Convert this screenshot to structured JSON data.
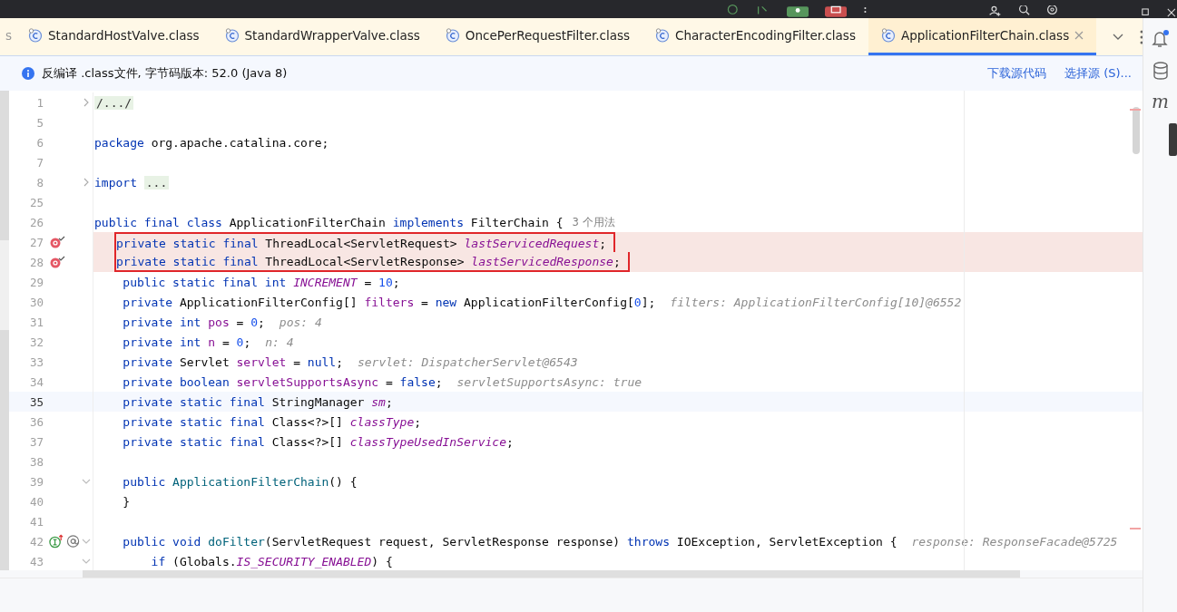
{
  "tabs": [
    {
      "label": "s",
      "icon": false,
      "selected": false,
      "closable": false
    },
    {
      "label": "StandardHostValve.class",
      "icon": true,
      "selected": false,
      "closable": false
    },
    {
      "label": "StandardWrapperValve.class",
      "icon": true,
      "selected": false,
      "closable": false
    },
    {
      "label": "OncePerRequestFilter.class",
      "icon": true,
      "selected": false,
      "closable": false
    },
    {
      "label": "CharacterEncodingFilter.class",
      "icon": true,
      "selected": false,
      "closable": false
    },
    {
      "label": "ApplicationFilterChain.class",
      "icon": true,
      "selected": true,
      "closable": true
    }
  ],
  "info_bar": {
    "message": "反编译 .class文件, 字节码版本: 52.0 (Java 8)",
    "links": [
      "下载源代码",
      "选择源 (S)..."
    ]
  },
  "side_toolbar": {
    "letter_tool": "m"
  },
  "lines": [
    {
      "num": "1",
      "expanded": false,
      "segments": [
        {
          "kind": "folded",
          "text": "/.../"
        }
      ]
    },
    {
      "num": "5"
    },
    {
      "num": "6",
      "segments": [
        {
          "kind": "kw",
          "text": "package "
        },
        {
          "kind": "plain",
          "text": "org.apache.catalina.core;"
        }
      ]
    },
    {
      "num": "7"
    },
    {
      "num": "8",
      "expanded": false,
      "segments": [
        {
          "kind": "kw",
          "text": "import "
        },
        {
          "kind": "folded",
          "text": "..."
        }
      ]
    },
    {
      "num": "25"
    },
    {
      "num": "26",
      "segments": [
        {
          "kind": "kw",
          "text": "public final class"
        },
        {
          "kind": "plain",
          "text": " ApplicationFilterChain "
        },
        {
          "kind": "kw",
          "text": "implements"
        },
        {
          "kind": "plain",
          "text": " FilterChain {"
        },
        {
          "kind": "usages",
          "text": "3 个用法"
        }
      ]
    },
    {
      "num": "27",
      "breakpoint": true,
      "highlighted": true,
      "boxed": true,
      "segments": [
        {
          "kind": "kw",
          "text": "    private static final"
        },
        {
          "kind": "plain",
          "text": " ThreadLocal<ServletRequest> "
        },
        {
          "kind": "static",
          "text": "lastServicedRequest"
        },
        {
          "kind": "plain",
          "text": ";"
        }
      ]
    },
    {
      "num": "28",
      "breakpoint": true,
      "highlighted": true,
      "boxed": true,
      "segments": [
        {
          "kind": "kw",
          "text": "    private static final"
        },
        {
          "kind": "plain",
          "text": " ThreadLocal<ServletResponse> "
        },
        {
          "kind": "static",
          "text": "lastServicedResponse"
        },
        {
          "kind": "plain",
          "text": ";"
        }
      ]
    },
    {
      "num": "29",
      "segments": [
        {
          "kind": "kw",
          "text": "    public static final int "
        },
        {
          "kind": "static",
          "text": "INCREMENT"
        },
        {
          "kind": "plain",
          "text": " = "
        },
        {
          "kind": "num",
          "text": "10"
        },
        {
          "kind": "plain",
          "text": ";"
        }
      ]
    },
    {
      "num": "30",
      "segments": [
        {
          "kind": "kw",
          "text": "    private"
        },
        {
          "kind": "plain",
          "text": " ApplicationFilterConfig[] "
        },
        {
          "kind": "field",
          "text": "filters"
        },
        {
          "kind": "plain",
          "text": " = "
        },
        {
          "kind": "kw",
          "text": "new"
        },
        {
          "kind": "plain",
          "text": " ApplicationFilterConfig["
        },
        {
          "kind": "num",
          "text": "0"
        },
        {
          "kind": "plain",
          "text": "];"
        },
        {
          "kind": "hint",
          "text": "filters: ApplicationFilterConfig[10]@6552"
        }
      ]
    },
    {
      "num": "31",
      "segments": [
        {
          "kind": "kw",
          "text": "    private int "
        },
        {
          "kind": "field",
          "text": "pos"
        },
        {
          "kind": "plain",
          "text": " = "
        },
        {
          "kind": "num",
          "text": "0"
        },
        {
          "kind": "plain",
          "text": ";"
        },
        {
          "kind": "hint",
          "text": "pos: 4"
        }
      ]
    },
    {
      "num": "32",
      "segments": [
        {
          "kind": "kw",
          "text": "    private int "
        },
        {
          "kind": "field",
          "text": "n"
        },
        {
          "kind": "plain",
          "text": " = "
        },
        {
          "kind": "num",
          "text": "0"
        },
        {
          "kind": "plain",
          "text": ";"
        },
        {
          "kind": "hint",
          "text": "n: 4"
        }
      ]
    },
    {
      "num": "33",
      "segments": [
        {
          "kind": "kw",
          "text": "    private"
        },
        {
          "kind": "plain",
          "text": " Servlet "
        },
        {
          "kind": "field",
          "text": "servlet"
        },
        {
          "kind": "plain",
          "text": " = "
        },
        {
          "kind": "kw",
          "text": "null"
        },
        {
          "kind": "plain",
          "text": ";"
        },
        {
          "kind": "hint",
          "text": "servlet: DispatcherServlet@6543"
        }
      ]
    },
    {
      "num": "34",
      "segments": [
        {
          "kind": "kw",
          "text": "    private boolean "
        },
        {
          "kind": "field",
          "text": "servletSupportsAsync"
        },
        {
          "kind": "plain",
          "text": " = "
        },
        {
          "kind": "kw",
          "text": "false"
        },
        {
          "kind": "plain",
          "text": ";"
        },
        {
          "kind": "hint",
          "text": "servletSupportsAsync: true"
        }
      ]
    },
    {
      "num": "35",
      "current": true,
      "segments": [
        {
          "kind": "kw",
          "text": "    private static final"
        },
        {
          "kind": "plain",
          "text": " StringManager "
        },
        {
          "kind": "static",
          "text": "sm"
        },
        {
          "kind": "plain",
          "text": ";"
        }
      ]
    },
    {
      "num": "36",
      "segments": [
        {
          "kind": "kw",
          "text": "    private static final"
        },
        {
          "kind": "plain",
          "text": " Class<?>[] "
        },
        {
          "kind": "static",
          "text": "classType"
        },
        {
          "kind": "plain",
          "text": ";"
        }
      ]
    },
    {
      "num": "37",
      "segments": [
        {
          "kind": "kw",
          "text": "    private static final"
        },
        {
          "kind": "plain",
          "text": " Class<?>[] "
        },
        {
          "kind": "static",
          "text": "classTypeUsedInService"
        },
        {
          "kind": "plain",
          "text": ";"
        }
      ]
    },
    {
      "num": "38"
    },
    {
      "num": "39",
      "expanded": true,
      "segments": [
        {
          "kind": "kw",
          "text": "    public "
        },
        {
          "kind": "method",
          "text": "ApplicationFilterChain"
        },
        {
          "kind": "plain",
          "text": "() {"
        }
      ]
    },
    {
      "num": "40",
      "segments": [
        {
          "kind": "plain",
          "text": "    }"
        }
      ]
    },
    {
      "num": "41"
    },
    {
      "num": "42",
      "implements": true,
      "expanded": true,
      "segments": [
        {
          "kind": "kw",
          "text": "    public void "
        },
        {
          "kind": "method",
          "text": "doFilter"
        },
        {
          "kind": "plain",
          "text": "(ServletRequest request, ServletResponse response) "
        },
        {
          "kind": "kw",
          "text": "throws"
        },
        {
          "kind": "plain",
          "text": " IOException, ServletException {"
        },
        {
          "kind": "hint",
          "text": "response: ResponseFacade@5725"
        }
      ]
    },
    {
      "num": "43",
      "expanded": true,
      "segments": [
        {
          "kind": "kw",
          "text": "        if"
        },
        {
          "kind": "plain",
          "text": " (Globals."
        },
        {
          "kind": "static",
          "text": "IS_SECURITY_ENABLED"
        },
        {
          "kind": "plain",
          "text": ") {"
        }
      ]
    }
  ]
}
